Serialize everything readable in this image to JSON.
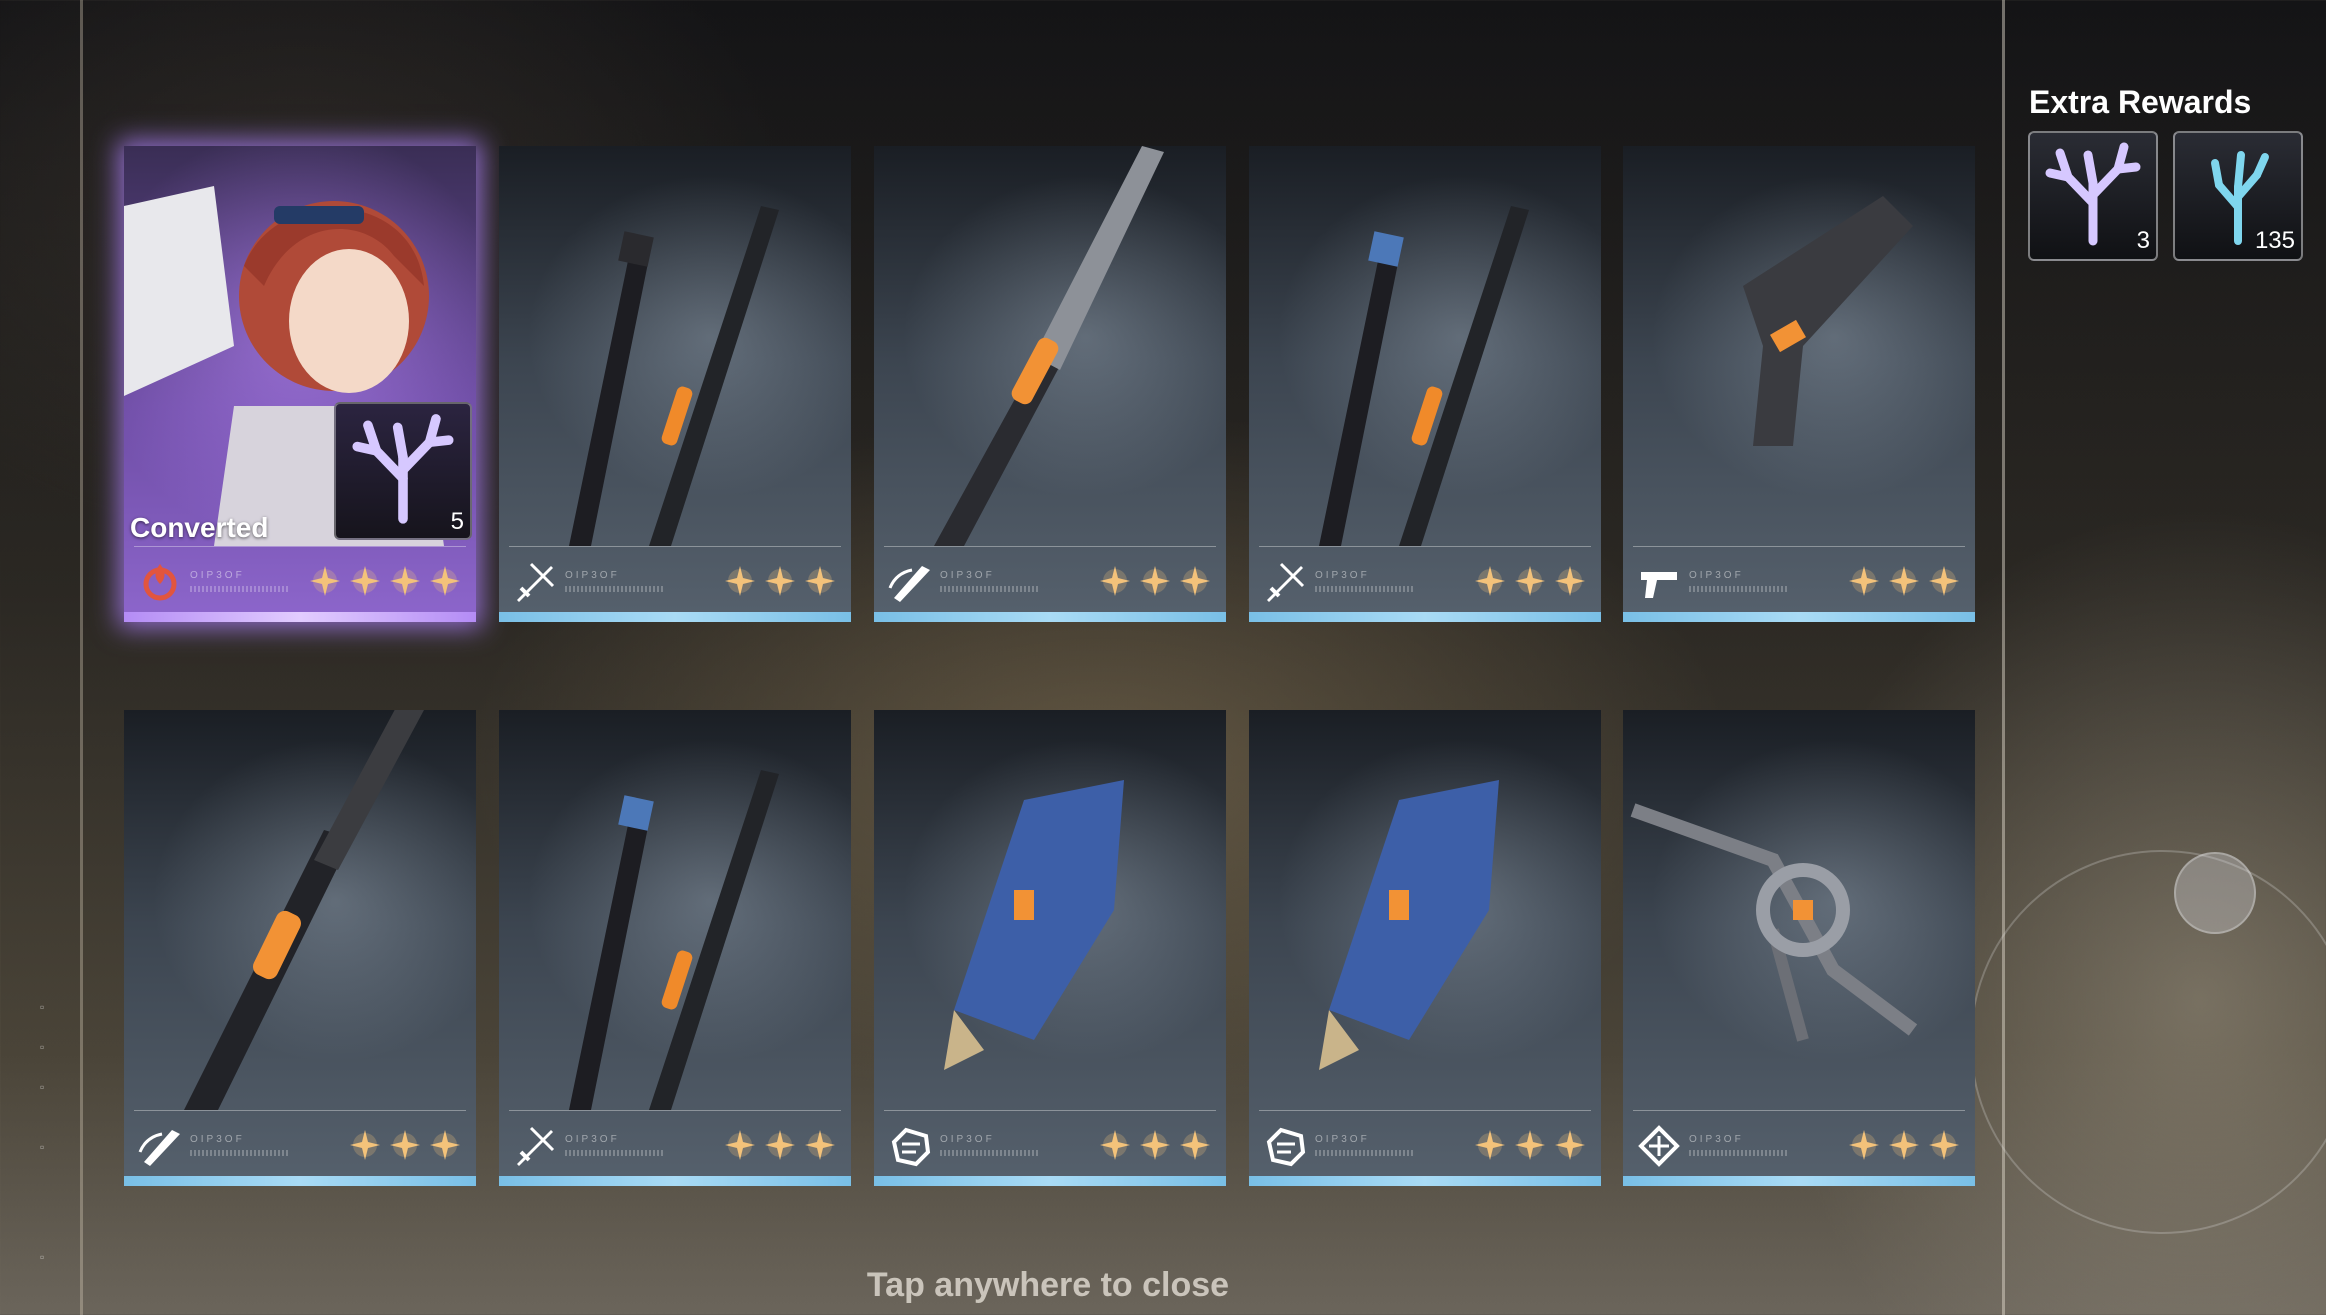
{
  "extra_rewards": {
    "title": "Extra Rewards",
    "items": [
      {
        "icon": "coral-crystal-icon",
        "count": "3",
        "color": "#c9b6ff"
      },
      {
        "icon": "coral-branch-icon",
        "count": "135",
        "color": "#7fd6ee"
      }
    ]
  },
  "cards": [
    {
      "kind": "character",
      "label": "Converted",
      "converted_item": {
        "icon": "coral-crystal-icon",
        "count": "5"
      },
      "element_icon": "fusion-flame-icon",
      "stars": 4,
      "accent": "#a97aff"
    },
    {
      "kind": "weapon",
      "weapon_icon": "sword-icon",
      "art": "twin-blades",
      "stars": 3
    },
    {
      "kind": "weapon",
      "weapon_icon": "broadblade-icon",
      "art": "broadblade",
      "stars": 3
    },
    {
      "kind": "weapon",
      "weapon_icon": "sword-icon",
      "art": "twin-blades-blue",
      "stars": 3
    },
    {
      "kind": "weapon",
      "weapon_icon": "pistol-icon",
      "art": "pistol",
      "stars": 3
    },
    {
      "kind": "weapon",
      "weapon_icon": "broadblade-icon",
      "art": "serrated-blade",
      "stars": 3
    },
    {
      "kind": "weapon",
      "weapon_icon": "sword-icon",
      "art": "twin-blades-blue",
      "stars": 3
    },
    {
      "kind": "weapon",
      "weapon_icon": "gauntlet-icon",
      "art": "gauntlet",
      "stars": 3
    },
    {
      "kind": "weapon",
      "weapon_icon": "gauntlet-icon",
      "art": "gauntlet",
      "stars": 3
    },
    {
      "kind": "weapon",
      "weapon_icon": "rectifier-icon",
      "art": "rectifier",
      "stars": 3
    }
  ],
  "close_hint": "Tap anywhere to close",
  "colors": {
    "star": "#f3c27a",
    "card_bar": "#8fcff0",
    "featured_glow": "#b184ff"
  }
}
